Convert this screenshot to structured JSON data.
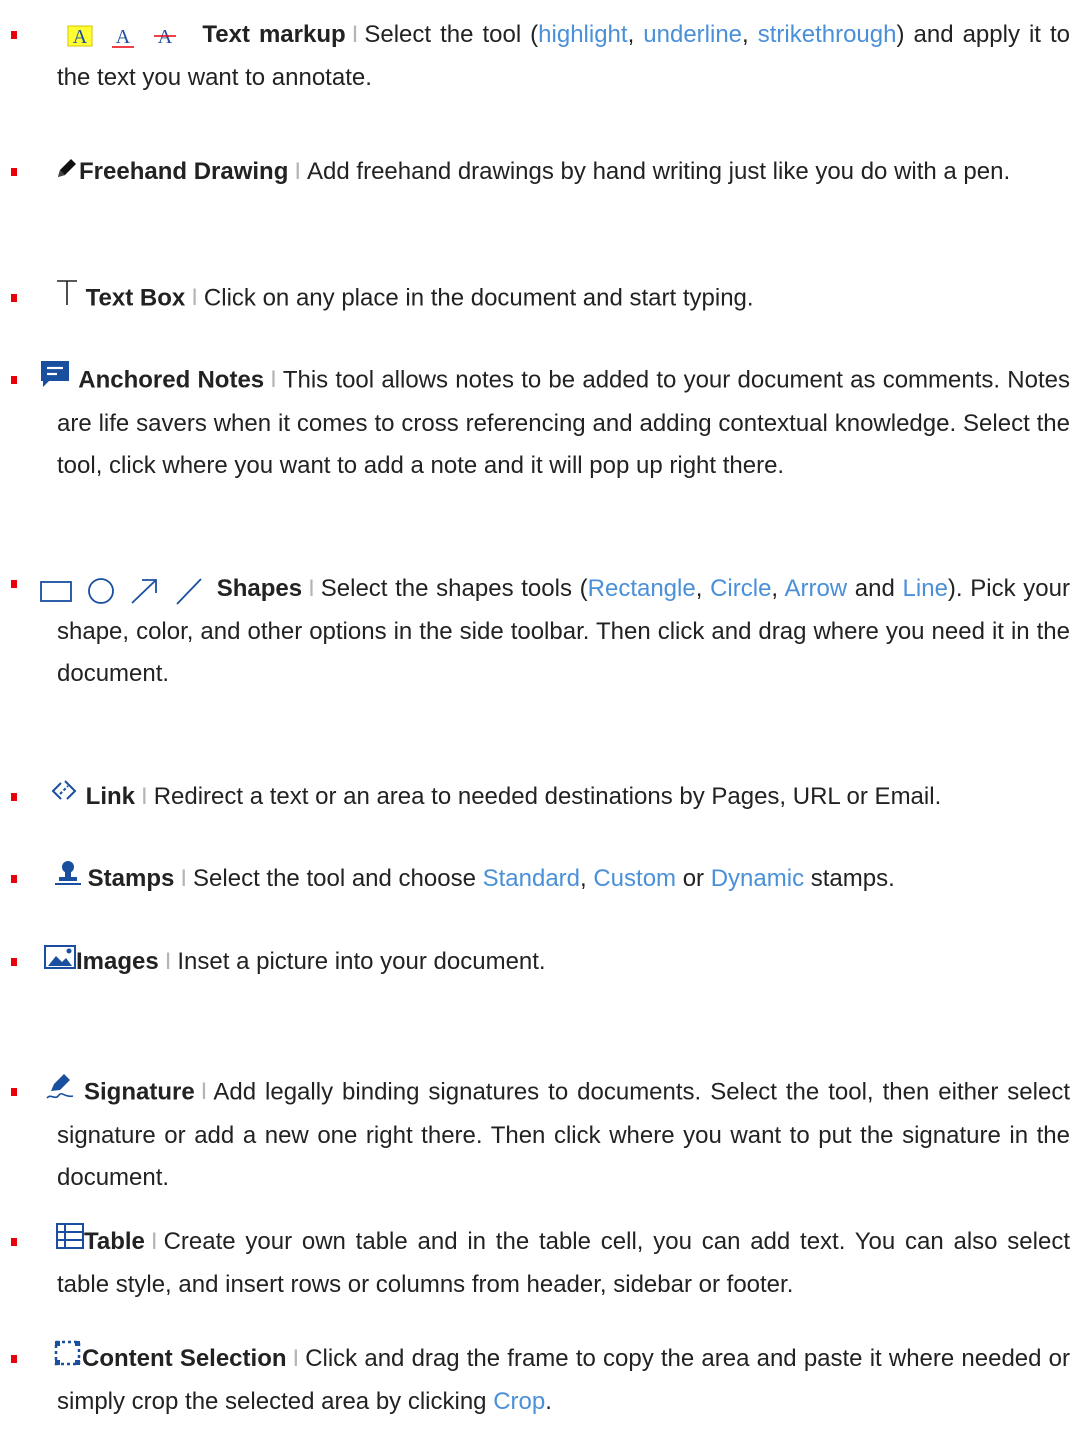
{
  "colors": {
    "bullet": "#e8000b",
    "link": "#4a90d9",
    "text": "#222222",
    "separator": "#b5b5b5",
    "highlight": "#ffff33",
    "underline": "#e8000b"
  },
  "separator": "I",
  "items": [
    {
      "icons": [
        "highlight-icon",
        "underline-icon",
        "strikethrough-icon"
      ],
      "title": "Text markup",
      "p1": "Select the tool (",
      "l1": "highlight",
      "p2": ", ",
      "l2": "underline",
      "p3": ", ",
      "l3": "strikethrough",
      "p4": ") and apply it to the text you want to annotate."
    },
    {
      "icons": [
        "pen-icon"
      ],
      "title": "Freehand Drawing",
      "body": "Add freehand drawings by hand writing just like you do with a pen."
    },
    {
      "icons": [
        "text-box-icon"
      ],
      "title": "Text Box",
      "body": "Click on any place in the document and start typing."
    },
    {
      "icons": [
        "note-icon"
      ],
      "title": "Anchored Notes",
      "body": "This tool allows notes to be added to your document as comments. Notes are life savers when it comes to cross referencing and adding contextual knowledge. Select the tool, click where you want to add a note and it will pop up right there."
    },
    {
      "icons": [
        "rectangle-icon",
        "circle-icon",
        "arrow-icon",
        "line-icon"
      ],
      "title": "Shapes",
      "p1": "Select the shapes tools (",
      "l1": "Rectangle",
      "p2": ", ",
      "l2": "Circle",
      "p3": ", ",
      "l3": "Arrow",
      "p4": " and ",
      "l4": "Line",
      "p5": "). Pick your shape, color, and other options in the side toolbar. Then click and drag where you need it in the document."
    },
    {
      "icons": [
        "link-icon"
      ],
      "title": "Link",
      "body": "Redirect a text or an area to needed destinations by Pages, URL or Email."
    },
    {
      "icons": [
        "stamp-icon"
      ],
      "title": "Stamps",
      "p1": "Select the tool and choose ",
      "l1": "Standard",
      "p2": ", ",
      "l2": "Custom",
      "p3": " or ",
      "l3": "Dynamic",
      "p4": " stamps."
    },
    {
      "icons": [
        "image-icon"
      ],
      "title": "Images",
      "body": "Inset a picture into your document."
    },
    {
      "icons": [
        "signature-icon"
      ],
      "title": "Signature",
      "body": "Add legally binding signatures to documents. Select the tool, then either select signature or add a new one right there. Then click where you want to put the signature in the document."
    },
    {
      "icons": [
        "table-icon"
      ],
      "title": "Table",
      "body": "Create your own table and in the table cell, you can add text. You can also select table style, and insert rows or columns from header, sidebar or footer."
    },
    {
      "icons": [
        "content-selection-icon"
      ],
      "title": "Content Selection",
      "p1": "Click and drag the frame to copy the area and paste it where needed or simply crop the selected area by clicking ",
      "l1": "Crop",
      "p2": "."
    }
  ]
}
